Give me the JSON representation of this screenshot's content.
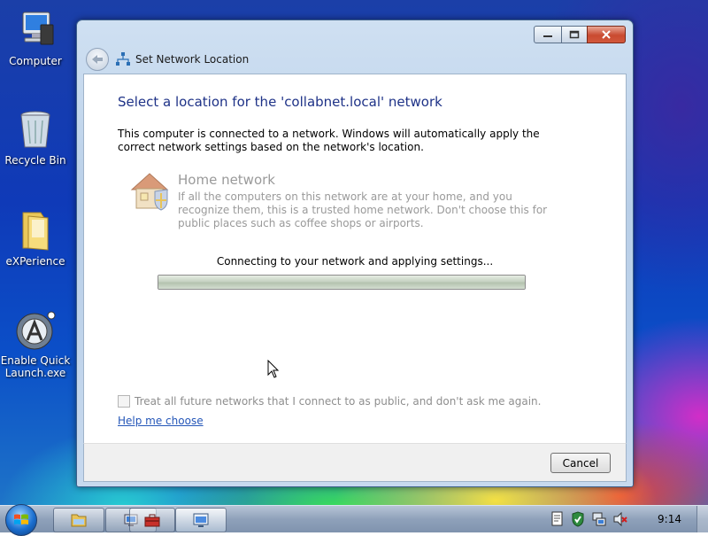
{
  "desktop": {
    "icons": [
      {
        "label": "Computer"
      },
      {
        "label": "Recycle Bin"
      },
      {
        "label": "eXPerience"
      },
      {
        "label_line1": "Enable Quick",
        "label_line2": "Launch.exe"
      }
    ]
  },
  "window": {
    "title": "Set Network Location",
    "heading": "Select a location for the 'collabnet.local' network",
    "description": "This computer is connected to a network. Windows will automatically apply the correct network settings based on the network's location.",
    "option": {
      "title": "Home network",
      "description": "If all the computers on this network are at your home, and you recognize them, this is a trusted home network.  Don't choose this for public places such as coffee shops or airports."
    },
    "progress": {
      "label": "Connecting to your network and applying settings...",
      "fraction": 1.0
    },
    "checkbox_label": "Treat all future networks that I connect to as public, and don't ask me again.",
    "checkbox_checked": false,
    "help_link": "Help me choose",
    "cancel_label": "Cancel"
  },
  "taskbar": {
    "clock": "9:14",
    "buttons": [
      "explorer",
      "network",
      "toolbox",
      "display"
    ]
  },
  "colors": {
    "heading": "#1e3287",
    "link": "#2456b8",
    "disabled_text": "#9a9a9a"
  }
}
